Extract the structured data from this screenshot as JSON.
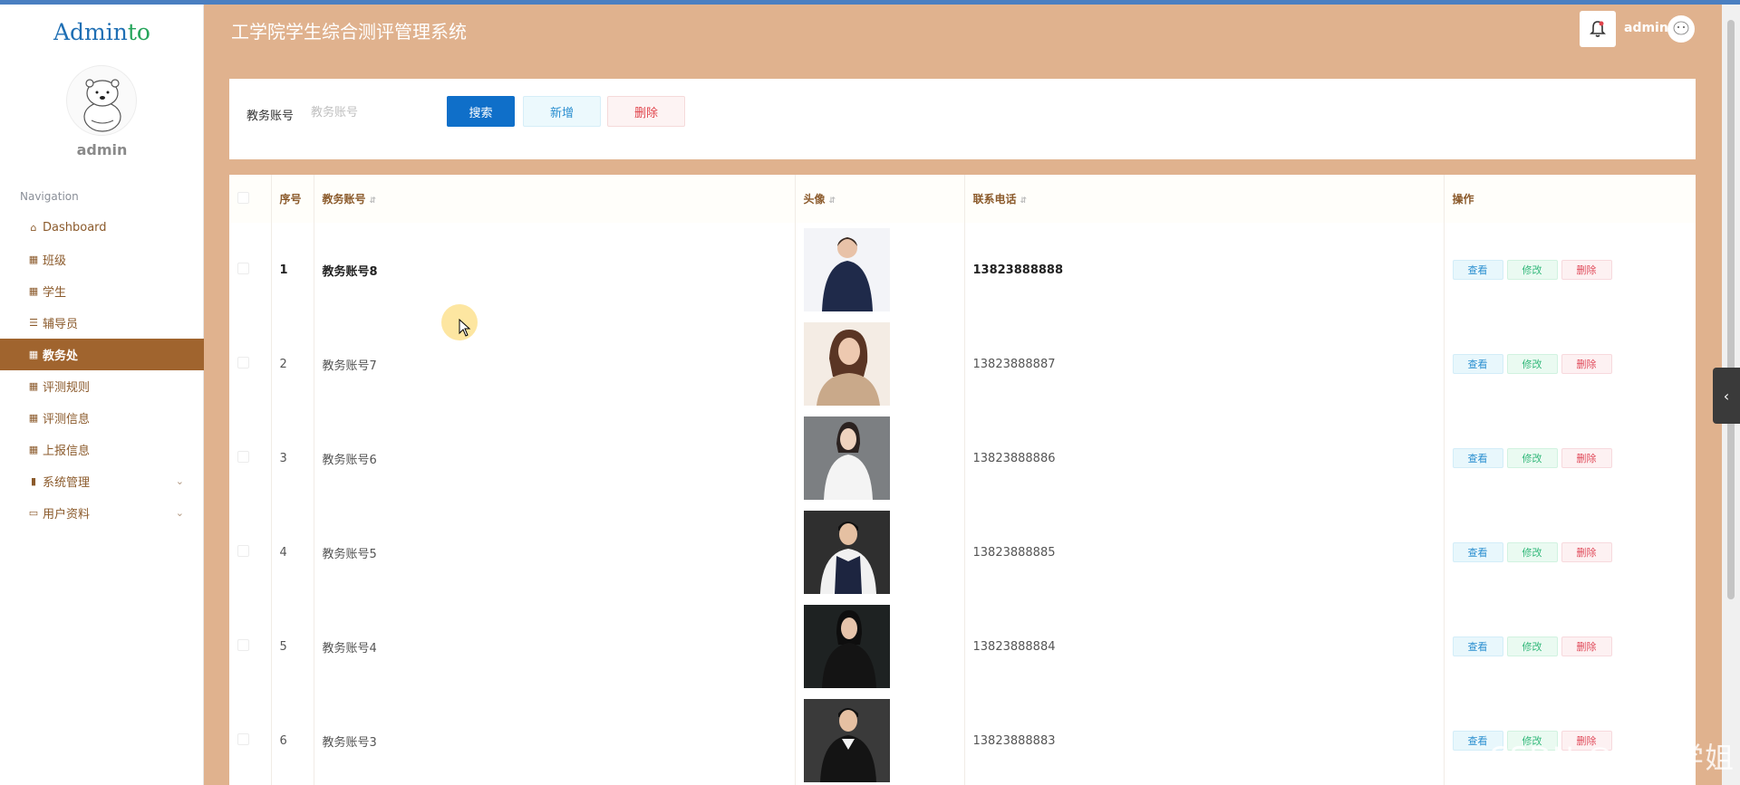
{
  "sidebar": {
    "logo_main": "Admin",
    "logo_accent": "to",
    "username": "admin",
    "nav_title": "Navigation",
    "items": [
      {
        "label": "Dashboard",
        "icon": "home-icon",
        "glyph": "⌂"
      },
      {
        "label": "班级",
        "icon": "grid-icon",
        "glyph": "▦"
      },
      {
        "label": "学生",
        "icon": "grid-icon",
        "glyph": "▦"
      },
      {
        "label": "辅导员",
        "icon": "list-icon",
        "glyph": "☰"
      },
      {
        "label": "教务处",
        "icon": "grid-icon",
        "glyph": "▦"
      },
      {
        "label": "评测规则",
        "icon": "grid-icon",
        "glyph": "▦"
      },
      {
        "label": "评测信息",
        "icon": "grid-icon",
        "glyph": "▦"
      },
      {
        "label": "上报信息",
        "icon": "grid-icon",
        "glyph": "▦"
      },
      {
        "label": "系统管理",
        "icon": "bar-chart-icon",
        "glyph": "▮"
      },
      {
        "label": "用户资料",
        "icon": "card-icon",
        "glyph": "▭"
      }
    ]
  },
  "header": {
    "title": "工学院学生综合测评管理系统",
    "username": "admin"
  },
  "search": {
    "label": "教务账号",
    "placeholder": "教务账号",
    "search_btn": "搜索",
    "add_btn": "新增",
    "delete_btn": "删除"
  },
  "table": {
    "columns": [
      "序号",
      "教务账号",
      "头像",
      "联系电话",
      "操作"
    ],
    "actions": {
      "view": "查看",
      "edit": "修改",
      "delete": "删除"
    },
    "rows": [
      {
        "index": "1",
        "account": "教务账号8",
        "phone": "13823888888"
      },
      {
        "index": "2",
        "account": "教务账号7",
        "phone": "13823888887"
      },
      {
        "index": "3",
        "account": "教务账号6",
        "phone": "13823888886"
      },
      {
        "index": "4",
        "account": "教务账号5",
        "phone": "13823888885"
      },
      {
        "index": "5",
        "account": "教务账号4",
        "phone": "13823888884"
      },
      {
        "index": "6",
        "account": "教务账号3",
        "phone": "13823888883"
      }
    ]
  },
  "watermark": "CSDN @茹茹学姐",
  "colors": {
    "page_bg": "#e0b28e",
    "nav_active": "#a0642e",
    "primary": "#0f6fc9"
  }
}
